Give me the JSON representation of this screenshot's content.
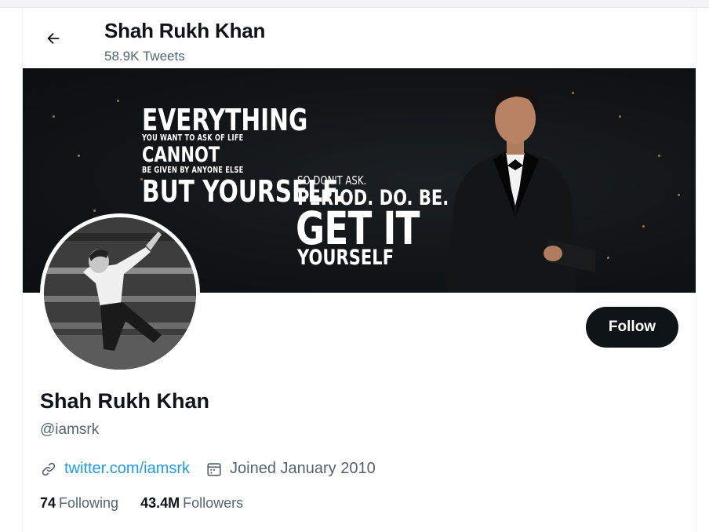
{
  "header": {
    "title": "Shah Rukh Khan",
    "tweet_count": "58.9K Tweets",
    "back_icon": "arrow-left-icon"
  },
  "banner": {
    "lines": [
      "EVERYTHING",
      "YOU WANT TO ASK OF LIFE",
      "CANNOT",
      "BE GIVEN BY ANYONE ELSE",
      "BUT YOURSELF.",
      "SO DON'T ASK.",
      "PERIOD. DO. BE.",
      "GET IT",
      "YOURSELF"
    ],
    "background": "#111518"
  },
  "profile": {
    "name": "Shah Rukh Khan",
    "handle": "@iamsrk",
    "website": "twitter.com/iamsrk",
    "joined": "Joined January 2010",
    "following_count": "74",
    "following_label": "Following",
    "followers_count": "43.4M",
    "followers_label": "Followers"
  },
  "actions": {
    "follow_label": "Follow"
  },
  "icons": {
    "link": "link-icon",
    "calendar": "calendar-icon"
  },
  "colors": {
    "accent": "#1d9bf0",
    "follow_button": "#0f1419",
    "secondary_text": "#536471"
  }
}
